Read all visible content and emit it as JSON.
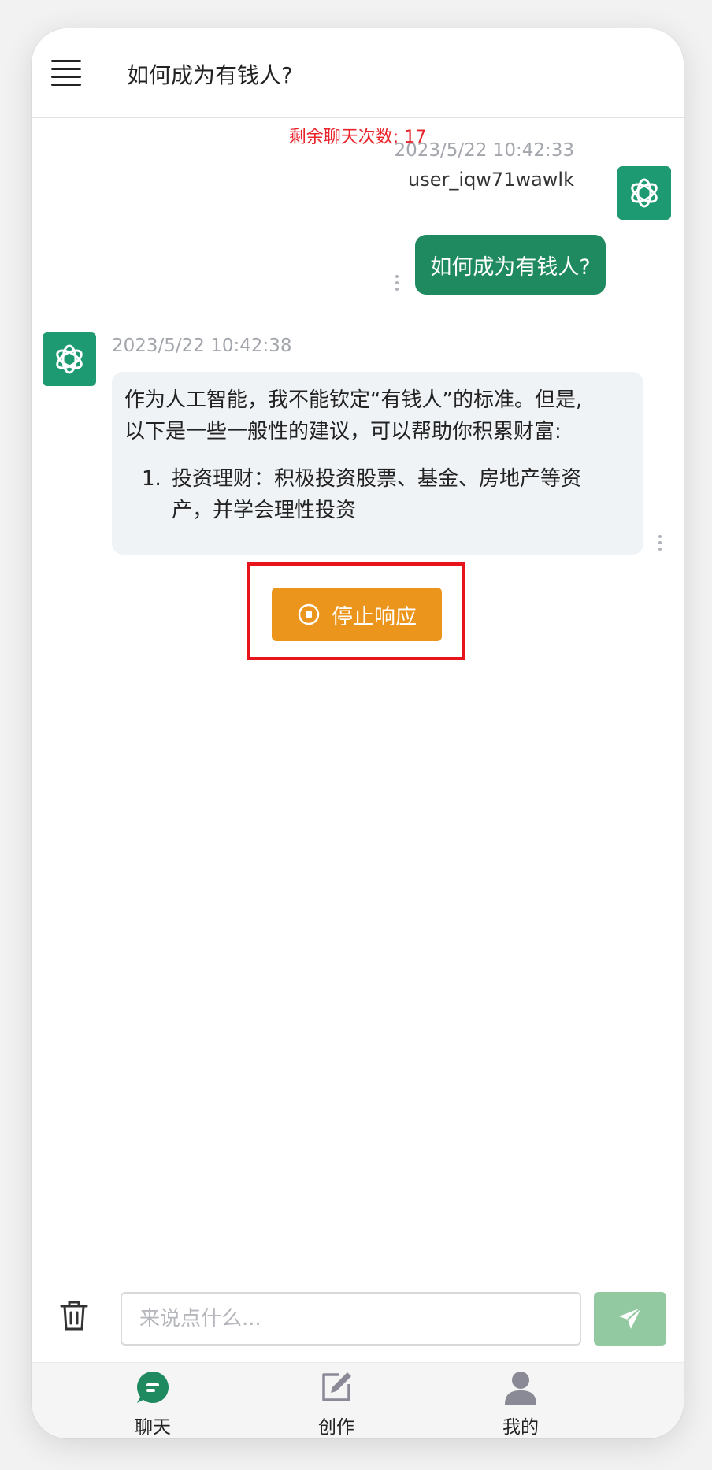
{
  "header": {
    "title": "如何成为有钱人?"
  },
  "quota_text": "剩余聊天次数: 17",
  "messages": {
    "user": {
      "timestamp": "2023/5/22 10:42:33",
      "username": "user_iqw71wawlk",
      "text": "如何成为有钱人?"
    },
    "bot": {
      "timestamp": "2023/5/22 10:42:38",
      "line1": "作为人工智能，我不能钦定“有钱人”的标准。但是,",
      "line2": "以下是一些一般性的建议，可以帮助你积累财富:",
      "list_num": "1.",
      "list_line1": "投资理财：积极投资股票、基金、房地产等资",
      "list_line2": "产，并学会理性投资"
    }
  },
  "stop_button_label": "停止响应",
  "input": {
    "placeholder": "来说点什么..."
  },
  "nav": {
    "items": [
      {
        "label": "聊天",
        "icon": "chat-icon",
        "active": true
      },
      {
        "label": "创作",
        "icon": "edit-icon"
      },
      {
        "label": "我的",
        "icon": "user-icon"
      }
    ]
  },
  "colors": {
    "brand_green": "#1f8a5f",
    "avatar_green": "#1e9a73",
    "stop_orange": "#ec951c",
    "quota_red": "#e8232a",
    "highlight_red": "#e8141c",
    "send_disabled_green": "#92c9a0"
  }
}
